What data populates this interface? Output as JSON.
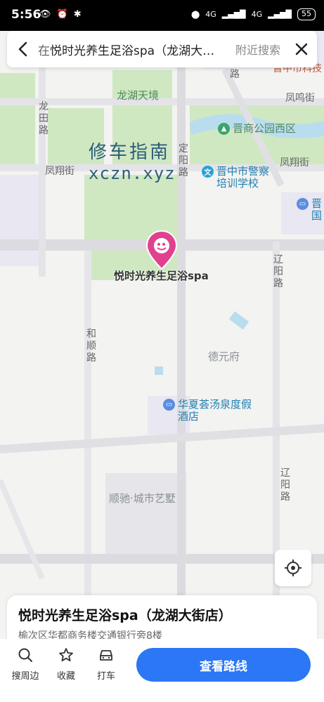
{
  "status": {
    "time": "5:56",
    "net1": "4G",
    "net2": "4G",
    "battery": "55"
  },
  "search": {
    "prefix": "在",
    "query": "悦时光养生足浴spa（龙湖大…",
    "nearby": "附近搜索"
  },
  "map": {
    "labels": {
      "longhu": "龙湖天境",
      "jinzhong_tech": "晋中市科技",
      "longtian_road": "龙田路",
      "fengming_street": "凤鸣街",
      "road_suffix": "路",
      "fengxiang_street": "凤翔街",
      "fengxiang_street_right": "凤翔街",
      "dingyang_road": "定阳路",
      "jinshang_park": "晋商公园西区",
      "police_school": "晋中市警察培训学校",
      "jin_right": "晋",
      "guo_right": "国",
      "liaoyang_road": "辽阳路",
      "heshun_road": "和顺路",
      "deyuanfu": "德元府",
      "hot_spring_hotel": "华夏荟汤泉度假酒店",
      "liaoyang_road_2": "辽阳路",
      "shunchi": "顺驰·城市艺墅"
    },
    "watermark_cn": "修车指南",
    "watermark_en": "xczn.xyz",
    "pin_label": "悦时光养生足浴spa",
    "poi_school_icon": "文"
  },
  "place": {
    "title": "悦时光养生足浴spa（龙湖大街店）",
    "address": "榆次区华都商务楼交通银行旁8楼"
  },
  "actions": {
    "nearby": "搜周边",
    "favorite": "收藏",
    "taxi": "打车",
    "route": "查看路线"
  },
  "colors": {
    "accent": "#2b77f5",
    "pin": "#e0418f",
    "park": "#cfe8c2",
    "water": "#b9dcef"
  }
}
